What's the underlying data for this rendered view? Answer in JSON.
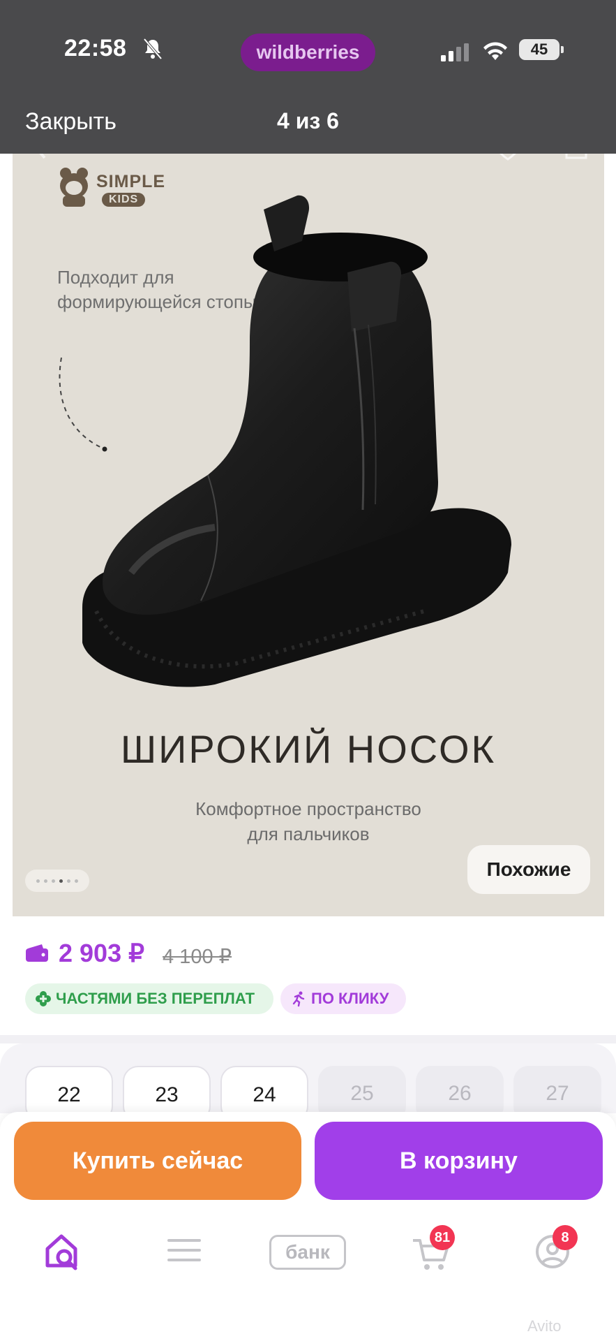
{
  "status_bar": {
    "time": "22:58",
    "brand": "wildberries",
    "battery": "45",
    "icons": [
      "bell-slash-icon",
      "signal-icon",
      "wifi-icon",
      "battery-icon"
    ]
  },
  "viewer": {
    "close_label": "Закрыть",
    "counter": "4 из 6"
  },
  "photo": {
    "brand_logo_top": "SIMPLE",
    "brand_logo_bottom": "KIDS",
    "feature_note": "Подходит для формирующейся стопы",
    "headline": "ШИРОКИЙ НОСОК",
    "subline_1": "Комфортное пространство",
    "subline_2": "для пальчиков",
    "similar_label": "Похожие"
  },
  "price": {
    "current": "2 903 ₽",
    "old": "4 100 ₽",
    "badge_installments": "ЧАСТЯМИ БЕЗ ПЕРЕПЛАТ",
    "badge_oneclick": "ПО КЛИКУ"
  },
  "sizes": [
    {
      "label": "22",
      "available": true
    },
    {
      "label": "23",
      "available": true
    },
    {
      "label": "24",
      "available": true
    },
    {
      "label": "25",
      "available": false
    },
    {
      "label": "26",
      "available": false
    },
    {
      "label": "27",
      "available": false
    }
  ],
  "actions": {
    "buy_now": "Купить сейчас",
    "add_to_cart": "В корзину"
  },
  "tab_bar": {
    "bank_label": "банк",
    "cart_badge": "81",
    "profile_badge": "8",
    "watermark": "Avito"
  },
  "colors": {
    "accent": "#a13fe9",
    "buy_now": "#f08a3a",
    "price": "#a23bd9",
    "badge_red": "#f23553"
  }
}
